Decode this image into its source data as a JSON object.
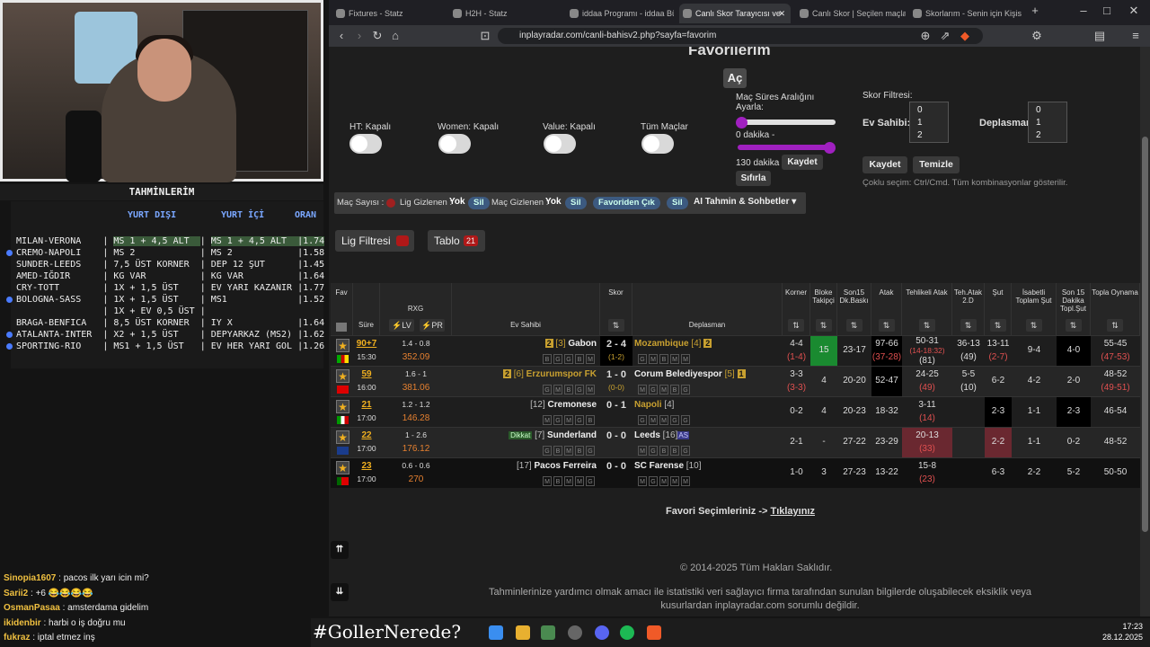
{
  "stream": {
    "tahminler_title": "TAHMİNLERİM",
    "headers": [
      "YURT DIŞI",
      "YURT İÇİ",
      "ORAN"
    ],
    "rows": [
      {
        "match": "MILAN-VERONA",
        "a": "MS 1 + 4,5 ALT",
        "b": "MS 1 + 4,5 ALT",
        "odd": "1.74",
        "hl": true,
        "dot": false
      },
      {
        "match": "CREMO-NAPOLI",
        "a": "MS 2",
        "b": "MS 2",
        "odd": "1.58",
        "hl": false,
        "dot": true
      },
      {
        "match": "SUNDER-LEEDS",
        "a": "7,5 ÜST KORNER",
        "b": "DEP 12 ŞUT",
        "odd": "1.45",
        "hl": false,
        "dot": false
      },
      {
        "match": "AMED-IĞDIR",
        "a": "KG VAR",
        "b": "KG VAR",
        "odd": "1.64",
        "hl": false,
        "dot": false
      },
      {
        "match": "CRY-TOTT",
        "a": "1X + 1,5 ÜST",
        "b": "EV YARI KAZANIR",
        "odd": "1.77",
        "hl": false,
        "dot": false
      },
      {
        "match": "BOLOGNA-SASS",
        "a": "1X + 1,5 ÜST",
        "b": "MS1",
        "odd": "1.52",
        "hl": false,
        "dot": true
      },
      {
        "match": "",
        "a": "1X + EV 0,5 ÜST",
        "b": "",
        "odd": "",
        "hl": false,
        "dot": false
      },
      {
        "match": "BRAGA-BENFICA",
        "a": "8,5 ÜST KORNER",
        "b": "IY X",
        "odd": "1.64",
        "hl": false,
        "dot": false
      },
      {
        "match": "ATALANTA-INTER",
        "a": "X2 + 1,5 ÜST",
        "b": "DEPYARKAZ (MS2)",
        "odd": "1.62",
        "hl": false,
        "dot": true
      },
      {
        "match": "SPORTING-RIO",
        "a": "MS1 + 1,5 ÜST",
        "b": "EV HER YARI GOL",
        "odd": "1.26",
        "hl": false,
        "dot": true
      }
    ],
    "chat": [
      {
        "user": "Sinopia1607",
        "msg": ": pacos ilk yarı icin mi?"
      },
      {
        "user": "Sarii2",
        "msg": ": +6 😂😂😂😂"
      },
      {
        "user": "OsmanPasaa",
        "msg": ": amsterdama gidelim"
      },
      {
        "user": "ikidenbir",
        "msg": ": harbi o iş doğru mu"
      },
      {
        "user": "fukraz",
        "msg": ": iptal etmez inş"
      }
    ],
    "hashtag": "#GollerNerede?"
  },
  "browser": {
    "tabs": [
      "Fixtures - Statz",
      "H2H - Statz",
      "iddaa Programı - iddaa Bü",
      "Canlı Skor Tarayıcısı ve",
      "Canlı Skor | Seçilen maçlar",
      "Skorlarım - Senin için Kişis"
    ],
    "url": "inplayradar.com/canli-bahisv2.php?sayfa=favorim"
  },
  "page": {
    "title": "Favorilerim",
    "open_btn": "Aç",
    "toggles": [
      "HT: Kapalı",
      "Women: Kapalı",
      "Value: Kapalı",
      "Tüm Maçlar"
    ],
    "range_label": "Maç Süres Aralığını Ayarla:",
    "min_label": "0 dakika -",
    "max_label": "130 dakika",
    "save_btn": "Kaydet",
    "reset_btn": "Sıfırla",
    "score_filter": "Skor Filtresi:",
    "home_label": "Ev Sahibi:",
    "away_label": "Deplasman:",
    "options": [
      "0",
      "1",
      "2"
    ],
    "save2": "Kaydet",
    "clear": "Temizle",
    "hint": "Çoklu seçim: Ctrl/Cmd. Tüm kombinasyonlar gösterilir.",
    "match_count": "Maç Sayısı :",
    "lig_hidden": "Lig Gizlenen :",
    "none": "Yok",
    "sil": "Sil",
    "mac_hidden": "Maç Gizlenen :",
    "fav_out": "Favoriden Çık",
    "ai": "AI Tahmin & Sohbetler",
    "lig_filter": "Lig Filtresi",
    "tablo": "Tablo",
    "tablo_count": "21",
    "footer_link_pre": "Favori Seçimleriniz ->",
    "footer_link": "Tıklayınız",
    "copyright": "© 2014-2025 Tüm Hakları Saklıdır.",
    "disclaimer": "Tahminlerinize yardımcı olmak amacı ile istatistiki veri sağlayıcı firma tarafından sunulan bilgilerde oluşabilecek eksiklik veya kusurlardan inplayradar.com sorumlu değildir."
  },
  "table": {
    "headers": [
      "Fav",
      "Süre",
      "RXG",
      "Ev Sahibi",
      "Skor",
      "Deplasman",
      "Korner",
      "Bloke Takipçi",
      "Son15 Dk.Baskı",
      "Atak",
      "Tehlikeli Atak",
      "Teh.Atak 2.D",
      "Şut",
      "İsabetli Toplam Şut",
      "Son 15 Dakika Topl.Şut",
      "Topla Oynama"
    ],
    "lv": "LV",
    "pr": "PR",
    "rows": [
      {
        "min": "90+7",
        "time": "15:30",
        "rxg": "1.4 - 0.8",
        "rxg2": "352.09",
        "home": "Gabon",
        "hrank": "[3]",
        "hbadge": "2",
        "hform": [
          "B",
          "G",
          "G",
          "B",
          "M"
        ],
        "score": "2 - 4",
        "ht": "(1-2)",
        "away": "Mozambique",
        "arank": "[4]",
        "abadge": "2",
        "aform": [
          "G",
          "M",
          "B",
          "M",
          "M"
        ],
        "korner": "4-4",
        "korner2": "(1-4)",
        "bloke": "15",
        "son15": "23-17",
        "atak": "97-66",
        "atak2": "(37-28)",
        "teh": "50-31",
        "teh2": "(14-18:32)",
        "teh3": "(81)",
        "teh2d": "36-13",
        "teh2d2": "(49)",
        "sut": "13-11",
        "sut2": "(2-7)",
        "isab": "9-4",
        "son15sut": "4-0",
        "topla": "55-45",
        "topla2": "(47-53)",
        "flag": "cm"
      },
      {
        "min": "59",
        "time": "16:00",
        "rxg": "1.6 - 1",
        "rxg2": "381.06",
        "home": "Erzurumspor FK",
        "hrank": "[6]",
        "hbadge": "2",
        "hform": [
          "G",
          "M",
          "B",
          "G",
          "M"
        ],
        "score": "1 - 0",
        "ht": "(0-0)",
        "away": "Corum Belediyespor",
        "arank": "[5]",
        "abadge": "1",
        "aform": [
          "M",
          "G",
          "M",
          "B",
          "G"
        ],
        "korner": "3-3",
        "korner2": "(3-3)",
        "bloke": "4",
        "son15": "20-20",
        "atak": "52-47",
        "atak2": "",
        "teh": "24-25",
        "teh2": "(49)",
        "teh3": "",
        "teh2d": "5-5",
        "teh2d2": "(10)",
        "sut": "6-2",
        "sut2": "",
        "isab": "4-2",
        "son15sut": "2-0",
        "topla": "48-52",
        "topla2": "(49-51)",
        "flag": "tr"
      },
      {
        "min": "21",
        "time": "17:00",
        "rxg": "1.2 - 1.2",
        "rxg2": "146.28",
        "home": "Cremonese",
        "hrank": "[12]",
        "hbadge": "",
        "hform": [
          "M",
          "G",
          "M",
          "G",
          "B"
        ],
        "score": "0 - 1",
        "ht": "",
        "away": "Napoli",
        "arank": "[4]",
        "abadge": "",
        "aform": [
          "G",
          "M",
          "M",
          "G",
          "G"
        ],
        "korner": "0-2",
        "korner2": "",
        "bloke": "4",
        "son15": "20-23",
        "atak": "18-32",
        "atak2": "",
        "teh": "3-11",
        "teh2": "(14)",
        "teh3": "",
        "teh2d": "",
        "teh2d2": "",
        "sut": "2-3",
        "sut2": "",
        "isab": "1-1",
        "son15sut": "2-3",
        "topla": "46-54",
        "topla2": "",
        "flag": "it"
      },
      {
        "min": "22",
        "time": "17:00",
        "rxg": "1 - 2.6",
        "rxg2": "176.12",
        "home": "Sunderland",
        "hrank": "[7]",
        "hbadge": "",
        "hform": [
          "G",
          "B",
          "M",
          "B",
          "G"
        ],
        "score": "0 - 0",
        "ht": "",
        "away": "Leeds",
        "arank": "[16]",
        "abadge": "",
        "aform": [
          "M",
          "G",
          "B",
          "B",
          "G"
        ],
        "korner": "2-1",
        "korner2": "",
        "bloke": "-",
        "son15": "27-22",
        "atak": "23-29",
        "atak2": "",
        "teh": "20-13",
        "teh2": "(33)",
        "teh3": "",
        "teh2d": "",
        "teh2d2": "",
        "sut": "2-2",
        "sut2": "",
        "isab": "1-1",
        "son15sut": "0-2",
        "topla": "48-52",
        "topla2": "",
        "flag": "gb"
      },
      {
        "min": "23",
        "time": "17:00",
        "rxg": "0.6 - 0.6",
        "rxg2": "270",
        "home": "Pacos Ferreira",
        "hrank": "[17]",
        "hbadge": "",
        "hform": [
          "M",
          "B",
          "M",
          "M",
          "G"
        ],
        "score": "0 - 0",
        "ht": "",
        "away": "SC Farense",
        "arank": "[10]",
        "abadge": "",
        "aform": [
          "M",
          "G",
          "M",
          "M",
          "M"
        ],
        "korner": "1-0",
        "korner2": "",
        "bloke": "3",
        "son15": "27-23",
        "atak": "13-22",
        "atak2": "",
        "teh": "15-8",
        "teh2": "(23)",
        "teh3": "",
        "teh2d": "",
        "teh2d2": "",
        "sut": "6-3",
        "sut2": "",
        "isab": "2-2",
        "son15sut": "5-2",
        "topla": "50-50",
        "topla2": "",
        "flag": "pt"
      }
    ],
    "dikkat": "Dikkat",
    "as": "AS"
  },
  "taskbar": {
    "time": "17:23",
    "date": "28.12.2025"
  }
}
